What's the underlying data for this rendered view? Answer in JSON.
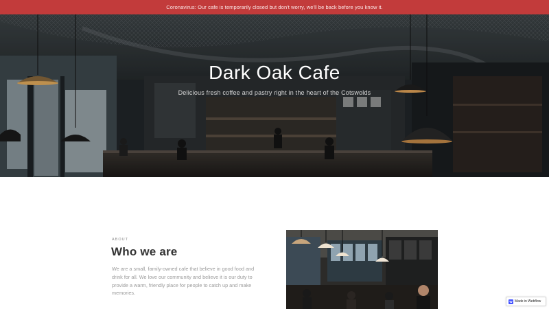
{
  "banner": {
    "text": "Coronavirus: Our cafe is temporarily closed but don't worry, we'll be back before you know it."
  },
  "hero": {
    "title": "Dark Oak Cafe",
    "subtitle": "Delicious fresh coffee and pastry right in the heart of the Cotswolds"
  },
  "about": {
    "eyebrow": "ABOUT",
    "heading": "Who we are",
    "body": "We are a small, family-owned cafe that believe in good food and drink for all. We love our community and believe it is our duty to provide a warm, friendly place for people to catch up and make memories."
  },
  "badge": {
    "label": "Made in Webflow",
    "logo": "W"
  },
  "colors": {
    "banner_bg": "#c23b3b",
    "hero_bg": "#1f2324",
    "accent": "#4353ff"
  },
  "icons": [
    "webflow-logo-icon"
  ]
}
